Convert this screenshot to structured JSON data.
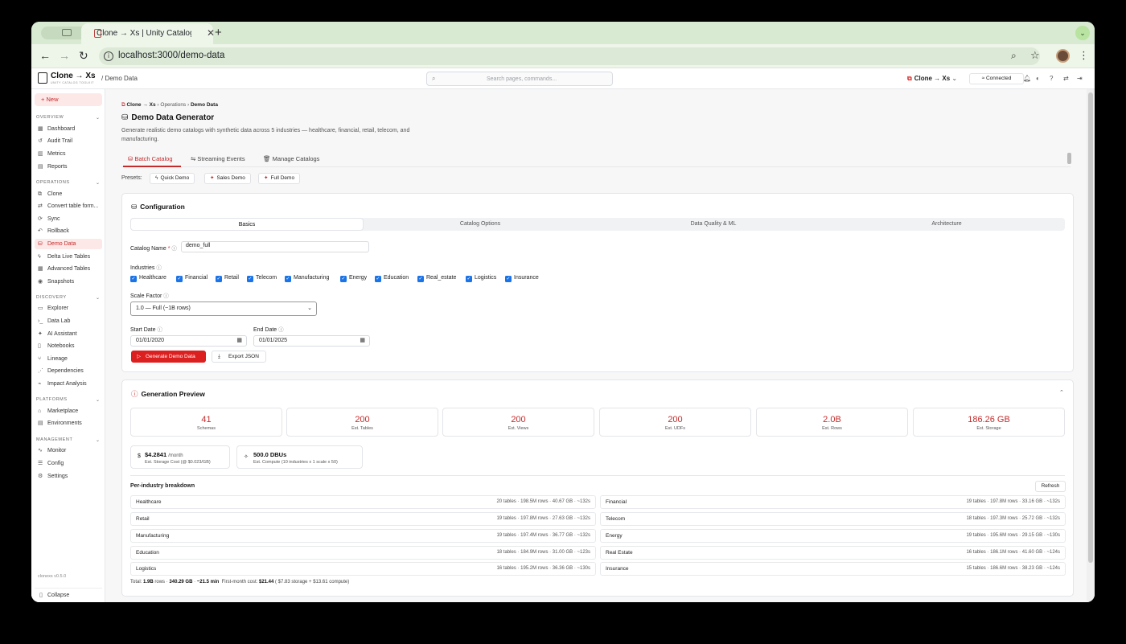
{
  "browser": {
    "tab_title": "Clone → Xs | Unity Catalog To",
    "url": "localhost:3000/demo-data"
  },
  "app": {
    "logo": "Clone → Xs",
    "logo_sub": "UNITY CATALOG TOOLKIT",
    "header_crumb": "Demo Data",
    "search_placeholder": "Search pages, commands...",
    "workspace": "Clone → Xs",
    "connection": "Connected"
  },
  "sidebar": {
    "new_label": "New",
    "sections": [
      {
        "title": "OVERVIEW",
        "items": [
          {
            "label": "Dashboard",
            "icon": "grid-icon"
          },
          {
            "label": "Audit Trail",
            "icon": "history-icon"
          },
          {
            "label": "Metrics",
            "icon": "chart-icon"
          },
          {
            "label": "Reports",
            "icon": "file-icon"
          }
        ]
      },
      {
        "title": "OPERATIONS",
        "items": [
          {
            "label": "Clone",
            "icon": "copy-icon"
          },
          {
            "label": "Convert table form...",
            "icon": "convert-icon"
          },
          {
            "label": "Sync",
            "icon": "sync-icon"
          },
          {
            "label": "Rollback",
            "icon": "undo-icon"
          },
          {
            "label": "Demo Data",
            "icon": "database-icon"
          },
          {
            "label": "Delta Live Tables",
            "icon": "bolt-icon"
          },
          {
            "label": "Advanced Tables",
            "icon": "table-icon"
          },
          {
            "label": "Snapshots",
            "icon": "camera-icon"
          }
        ]
      },
      {
        "title": "DISCOVERY",
        "items": [
          {
            "label": "Explorer",
            "icon": "folder-icon"
          },
          {
            "label": "Data Lab",
            "icon": "terminal-icon"
          },
          {
            "label": "AI Assistant",
            "icon": "sparkle-icon"
          },
          {
            "label": "Notebooks",
            "icon": "book-icon"
          },
          {
            "label": "Lineage",
            "icon": "lineage-icon"
          },
          {
            "label": "Dependencies",
            "icon": "network-icon"
          },
          {
            "label": "Impact Analysis",
            "icon": "pulse-icon"
          }
        ]
      },
      {
        "title": "PLATFORMS",
        "items": [
          {
            "label": "Marketplace",
            "icon": "store-icon"
          },
          {
            "label": "Environments",
            "icon": "server-icon"
          }
        ]
      },
      {
        "title": "MANAGEMENT",
        "items": [
          {
            "label": "Monitor",
            "icon": "activity-icon"
          },
          {
            "label": "Config",
            "icon": "sliders-icon"
          },
          {
            "label": "Settings",
            "icon": "gear-icon"
          }
        ]
      }
    ],
    "version": "clonexs v0.5.0",
    "collapse_label": "Collapse"
  },
  "page": {
    "crumbs": [
      "Clone → Xs",
      "Operations",
      "Demo Data"
    ],
    "title": "Demo Data Generator",
    "description": "Generate realistic demo catalogs with synthetic data across 5 industries — healthcare, financial, retail, telecom, and manufacturing.",
    "tabs": [
      "Batch Catalog",
      "Streaming Events",
      "Manage Catalogs"
    ],
    "presets_label": "Presets:",
    "presets": [
      "Quick Demo",
      "Sales Demo",
      "Full Demo"
    ]
  },
  "config": {
    "title": "Configuration",
    "segments": [
      "Basics",
      "Catalog Options",
      "Data Quality & ML",
      "Architecture"
    ],
    "catalog_name_label": "Catalog Name",
    "catalog_name_value": "demo_full",
    "industries_label": "Industries",
    "industries": [
      "Healthcare",
      "Financial",
      "Retail",
      "Telecom",
      "Manufacturing",
      "Energy",
      "Education",
      "Real_estate",
      "Logistics",
      "Insurance"
    ],
    "scale_label": "Scale Factor",
    "scale_value": "1.0 — Full (~1B rows)",
    "start_label": "Start Date",
    "start_value": "01/01/2020",
    "end_label": "End Date",
    "end_value": "01/01/2025",
    "generate_label": "Generate Demo Data",
    "export_label": "Export JSON"
  },
  "preview": {
    "title": "Generation Preview",
    "stats": [
      {
        "value": "41",
        "label": "Schemas"
      },
      {
        "value": "200",
        "label": "Est. Tables"
      },
      {
        "value": "200",
        "label": "Est. Views"
      },
      {
        "value": "200",
        "label": "Est. UDFs"
      },
      {
        "value": "2.0B",
        "label": "Est. Rows"
      },
      {
        "value": "186.26 GB",
        "label": "Est. Storage"
      }
    ],
    "storage_cost": {
      "value": "$4.2841",
      "unit": "/month",
      "label": "Est. Storage Cost (@ $0.023/GB)"
    },
    "compute_cost": {
      "value": "500.0 DBUs",
      "label": "Est. Compute (10 industries x 1 scale x 50)"
    },
    "breakdown_title": "Per-industry breakdown",
    "refresh_label": "Refresh",
    "rows": [
      {
        "name": "Healthcare",
        "stats": "20 tables · 198.5M rows · 40.67 GB · ~132s"
      },
      {
        "name": "Financial",
        "stats": "19 tables · 197.8M rows · 33.16 GB · ~132s"
      },
      {
        "name": "Retail",
        "stats": "19 tables · 197.8M rows · 27.63 GB · ~132s"
      },
      {
        "name": "Telecom",
        "stats": "18 tables · 197.3M rows · 25.72 GB · ~132s"
      },
      {
        "name": "Manufacturing",
        "stats": "19 tables · 197.4M rows · 36.77 GB · ~132s"
      },
      {
        "name": "Energy",
        "stats": "19 tables · 195.6M rows · 29.15 GB · ~130s"
      },
      {
        "name": "Education",
        "stats": "18 tables · 184.9M rows · 31.00 GB · ~123s"
      },
      {
        "name": "Real Estate",
        "stats": "16 tables · 186.1M rows · 41.60 GB · ~124s"
      },
      {
        "name": "Logistics",
        "stats": "16 tables · 195.2M rows · 36.36 GB · ~130s"
      },
      {
        "name": "Insurance",
        "stats": "15 tables · 186.6M rows · 38.23 GB · ~124s"
      }
    ],
    "totals": {
      "prefix": "Total:",
      "rows": "1.9B",
      "rows_unit": "rows ·",
      "size": "340.29 GB",
      "sep": "·",
      "time": "~21.5 min",
      "cost_label": "First-month cost:",
      "cost": "$21.44",
      "cost_detail": "( $7.83 storage + $13.61 compute)"
    }
  }
}
